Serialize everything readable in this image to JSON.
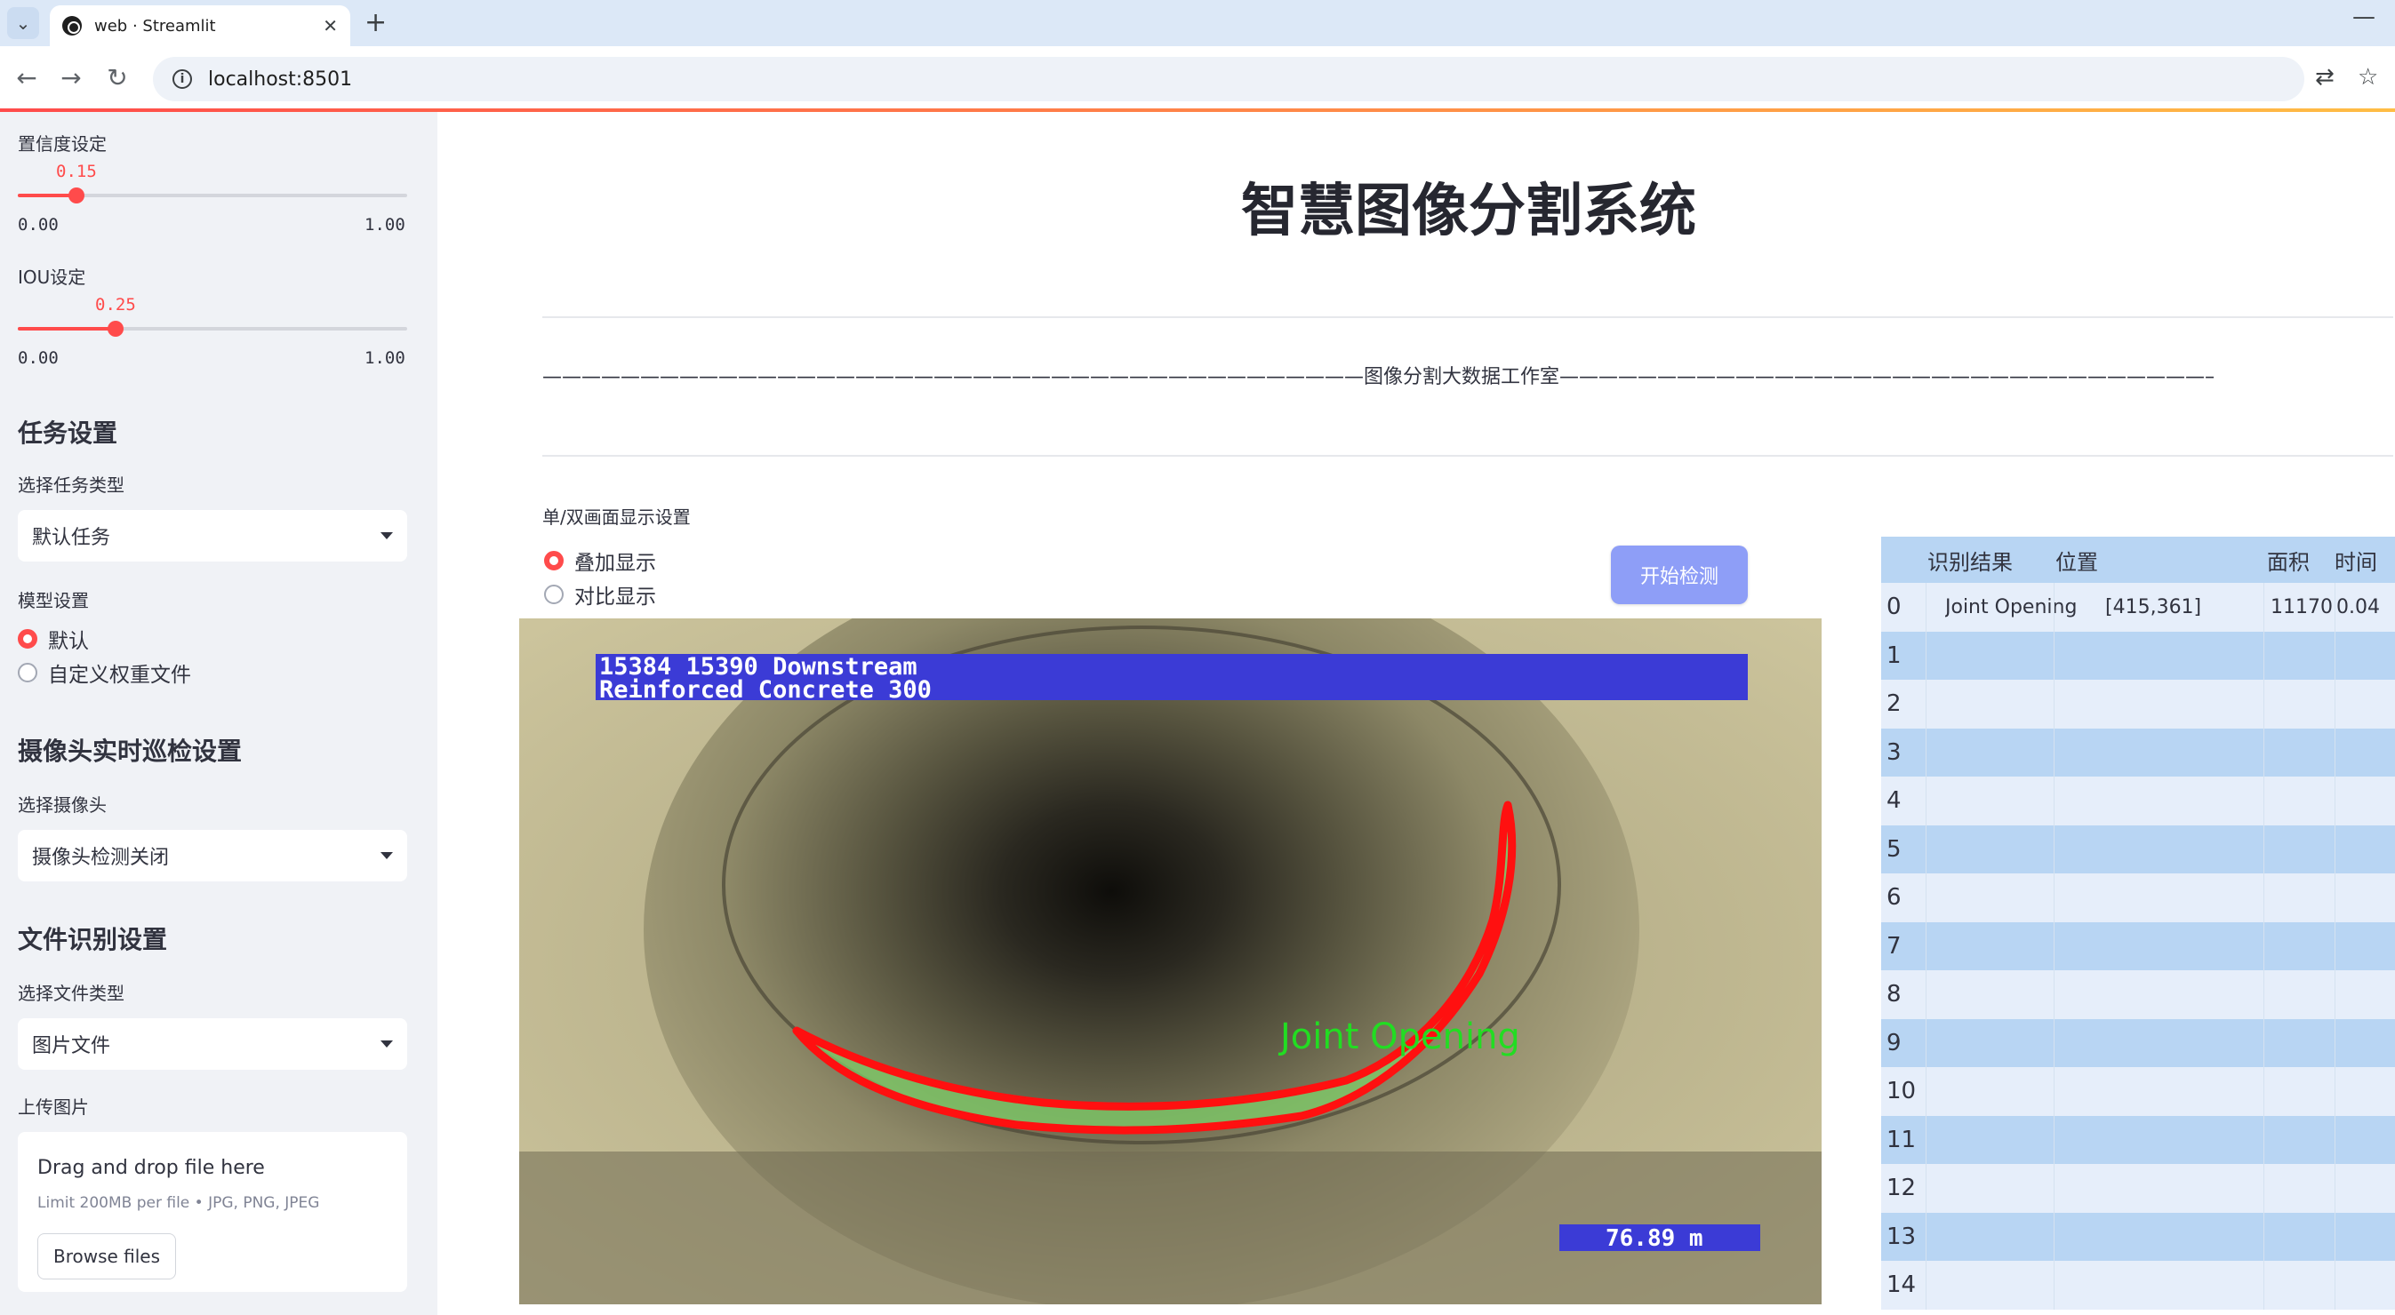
{
  "browser": {
    "tab_title": "web · Streamlit",
    "url": "localhost:8501"
  },
  "sidebar": {
    "confidence": {
      "label": "置信度设定",
      "value": "0.15",
      "fraction": 0.15,
      "min": "0.00",
      "max": "1.00"
    },
    "iou": {
      "label": "IOU设定",
      "value": "0.25",
      "fraction": 0.25,
      "min": "0.00",
      "max": "1.00"
    },
    "task_section": {
      "title": "任务设置",
      "select_label": "选择任务类型",
      "selected": "默认任务"
    },
    "model_section": {
      "label": "模型设置",
      "options": [
        "默认",
        "自定义权重文件"
      ],
      "selected_index": 0
    },
    "camera_section": {
      "title": "摄像头实时巡检设置",
      "select_label": "选择摄像头",
      "selected": "摄像头检测关闭"
    },
    "file_section": {
      "title": "文件识别设置",
      "select_label": "选择文件类型",
      "selected": "图片文件"
    },
    "upload": {
      "label": "上传图片",
      "drop_text": "Drag and drop file here",
      "limit_text": "Limit 200MB per file • JPG, PNG, JPEG",
      "button": "Browse files"
    }
  },
  "main": {
    "title": "智慧图像分割系统",
    "banner": "——————————————————————————————————————————图像分割大数据工作室——————————————————————————————————————————",
    "display_label": "单/双画面显示设置",
    "display_options": [
      "叠加显示",
      "对比显示"
    ],
    "display_selected_index": 0,
    "start_button": "开始检测",
    "image": {
      "overlay_line1": "15384 15390 Downstream",
      "overlay_line2": "Reinforced Concrete 300",
      "distance": "76.89 m",
      "detection_label": "Joint Opening",
      "colors": {
        "mask_outline": "#ff1010",
        "mask_fill": "#7fd06a",
        "label_text": "#22dd22",
        "overlay_bg": "#3b3bd6"
      }
    }
  },
  "results_table": {
    "headers": [
      "识别结果",
      "位置",
      "面积",
      "时间"
    ],
    "rows": [
      {
        "index": "0",
        "result": "Joint Opening",
        "position": "[415,361]",
        "area": "11170",
        "time": "0.04"
      },
      {
        "index": "1",
        "result": "",
        "position": "",
        "area": "",
        "time": ""
      },
      {
        "index": "2",
        "result": "",
        "position": "",
        "area": "",
        "time": ""
      },
      {
        "index": "3",
        "result": "",
        "position": "",
        "area": "",
        "time": ""
      },
      {
        "index": "4",
        "result": "",
        "position": "",
        "area": "",
        "time": ""
      },
      {
        "index": "5",
        "result": "",
        "position": "",
        "area": "",
        "time": ""
      },
      {
        "index": "6",
        "result": "",
        "position": "",
        "area": "",
        "time": ""
      },
      {
        "index": "7",
        "result": "",
        "position": "",
        "area": "",
        "time": ""
      },
      {
        "index": "8",
        "result": "",
        "position": "",
        "area": "",
        "time": ""
      },
      {
        "index": "9",
        "result": "",
        "position": "",
        "area": "",
        "time": ""
      },
      {
        "index": "10",
        "result": "",
        "position": "",
        "area": "",
        "time": ""
      },
      {
        "index": "11",
        "result": "",
        "position": "",
        "area": "",
        "time": ""
      },
      {
        "index": "12",
        "result": "",
        "position": "",
        "area": "",
        "time": ""
      },
      {
        "index": "13",
        "result": "",
        "position": "",
        "area": "",
        "time": ""
      },
      {
        "index": "14",
        "result": "",
        "position": "",
        "area": "",
        "time": ""
      }
    ]
  },
  "icons": {
    "tab_menu": "chevron-down-icon",
    "back": "arrow-left-icon",
    "forward": "arrow-right-icon",
    "reload": "reload-icon",
    "site_info": "info-icon",
    "translate": "translate-icon",
    "bookmark": "star-icon"
  }
}
